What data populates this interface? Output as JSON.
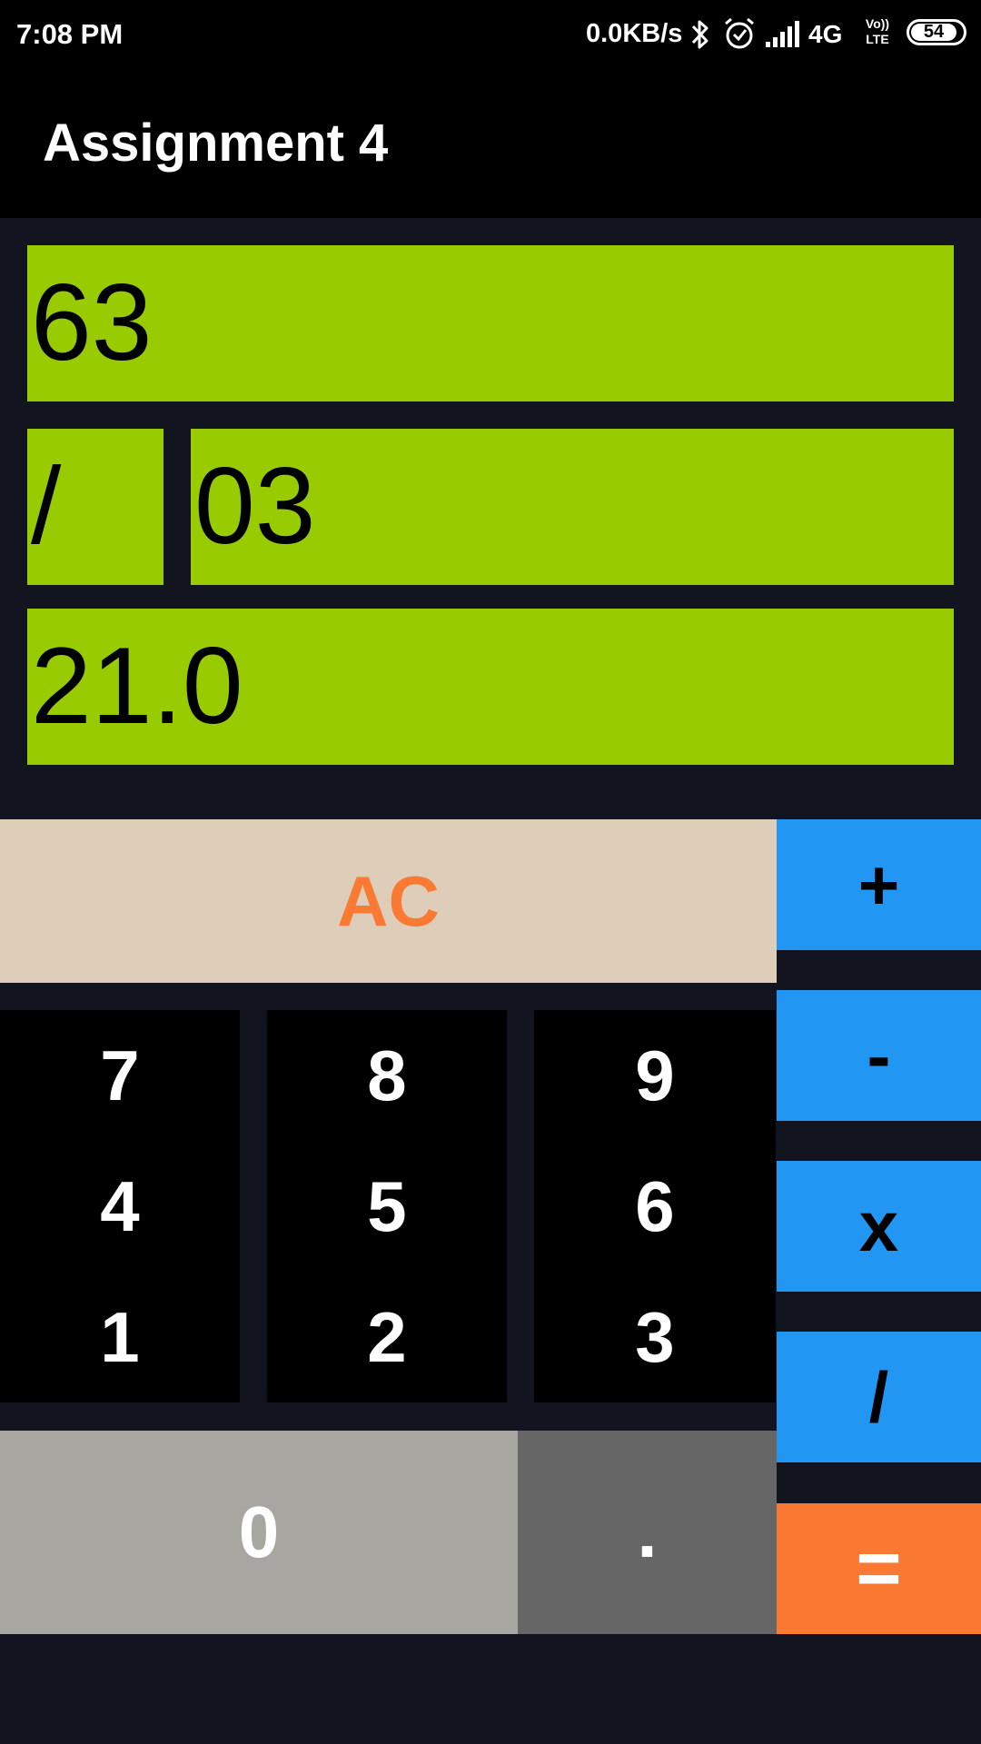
{
  "status_bar": {
    "time": "7:08 PM",
    "net_speed": "0.0KB/s",
    "network": "4G",
    "volte_top": "Vo))",
    "volte_bottom": "LTE",
    "battery": "54",
    "icons": [
      "bluetooth-icon",
      "alarm-icon",
      "signal-icon",
      "battery-icon"
    ]
  },
  "app_bar": {
    "title": "Assignment 4"
  },
  "display": {
    "operand_a": "63",
    "operator": "/",
    "operand_b": "03",
    "result": "21.0"
  },
  "keypad": {
    "clear": "AC",
    "digits": {
      "d7": "7",
      "d8": "8",
      "d9": "9",
      "d4": "4",
      "d5": "5",
      "d6": "6",
      "d1": "1",
      "d2": "2",
      "d3": "3",
      "d0": "0"
    },
    "dot": ".",
    "ops": {
      "plus": "+",
      "minus": "-",
      "multiply": "x",
      "divide": "/"
    },
    "equals": "="
  },
  "colors": {
    "background": "#121420",
    "field": "#99cc00",
    "operator_button": "#2196f3",
    "equals_button": "#fa7a34",
    "clear_button": "#decdb9",
    "clear_text": "#fa7a34",
    "zero_button": "#a8a6a1",
    "dot_button": "#666666"
  }
}
